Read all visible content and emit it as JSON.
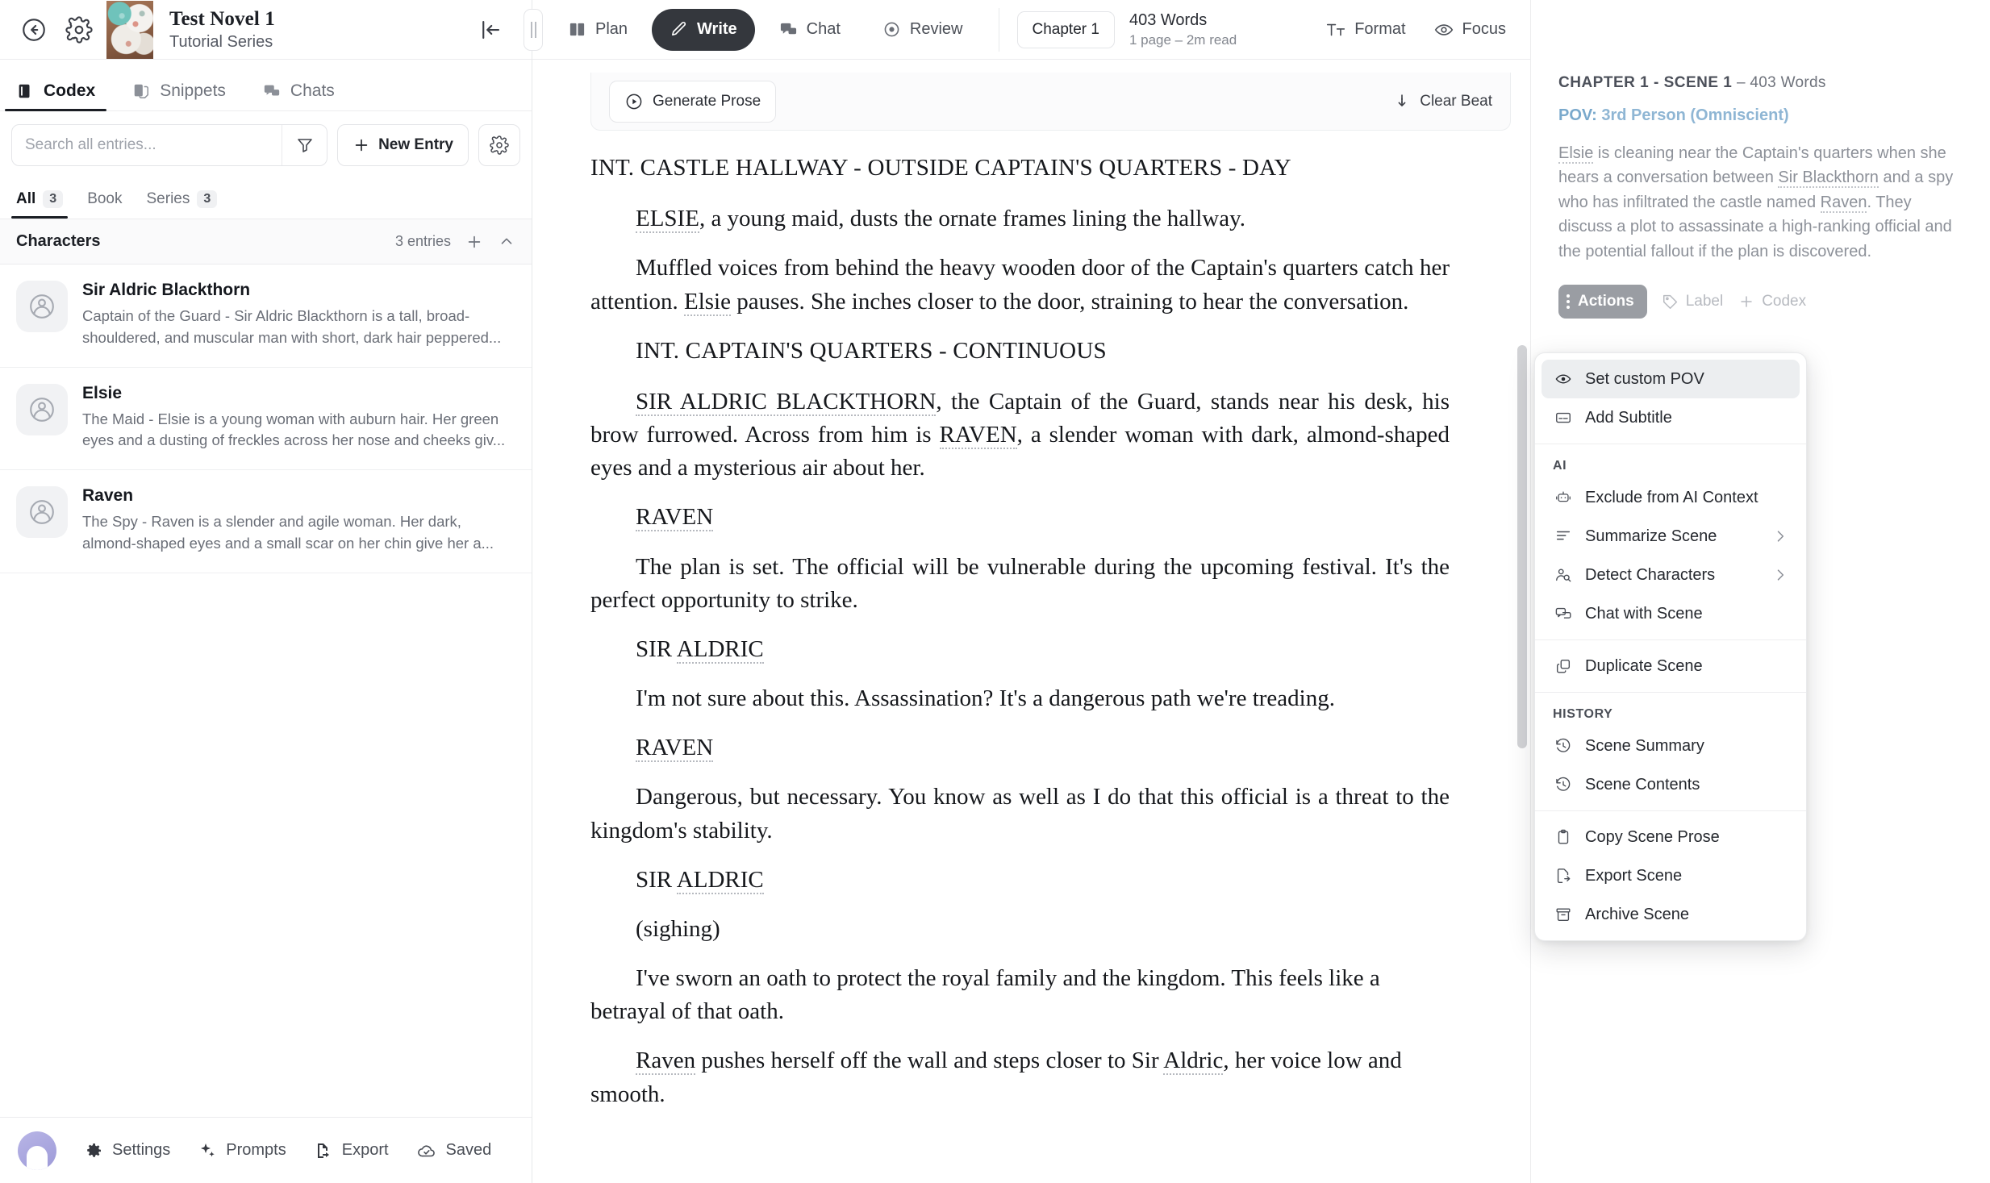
{
  "sidebar": {
    "novel_title": "Test Novel 1",
    "novel_series": "Tutorial Series",
    "back_icon": "back-arrow-icon",
    "settings_icon": "gear-icon",
    "collapse_icon": "collapse-panel-icon",
    "tabs": [
      {
        "label": "Codex",
        "icon": "book-icon",
        "active": true
      },
      {
        "label": "Snippets",
        "icon": "snippets-icon",
        "active": false
      },
      {
        "label": "Chats",
        "icon": "chat-bubbles-icon",
        "active": false
      }
    ],
    "search": {
      "placeholder": "Search all entries...",
      "value": ""
    },
    "filter_icon": "filter-funnel-icon",
    "new_entry_label": "New Entry",
    "entry_settings_icon": "gear-icon",
    "scope_tabs": [
      {
        "label": "All",
        "count": "3",
        "active": true
      },
      {
        "label": "Book",
        "count": "",
        "active": false
      },
      {
        "label": "Series",
        "count": "3",
        "active": false
      }
    ],
    "group": {
      "title": "Characters",
      "count_label": "3 entries",
      "add_icon": "plus-icon",
      "collapse_icon": "chevron-up-icon"
    },
    "entries": [
      {
        "name": "Sir Aldric Blackthorn",
        "description": "Captain of the Guard - Sir Aldric Blackthorn is a tall, broad-shouldered, and muscular man with short, dark hair peppered..."
      },
      {
        "name": "Elsie",
        "description": "The Maid - Elsie is a young woman with auburn hair. Her green eyes and a dusting of freckles across her nose and cheeks giv..."
      },
      {
        "name": "Raven",
        "description": "The Spy - Raven is a slender and agile woman. Her dark, almond-shaped eyes and a small scar on her chin give her a..."
      }
    ],
    "bottom": [
      {
        "label": "Settings",
        "icon": "gear-icon"
      },
      {
        "label": "Prompts",
        "icon": "sparkles-icon"
      },
      {
        "label": "Export",
        "icon": "export-file-icon"
      },
      {
        "label": "Saved",
        "icon": "cloud-check-icon"
      }
    ]
  },
  "topbar": {
    "modes": [
      {
        "label": "Plan",
        "icon": "book-open-icon",
        "active": false
      },
      {
        "label": "Write",
        "icon": "pencil-icon",
        "active": true
      },
      {
        "label": "Chat",
        "icon": "chat-bubbles-icon",
        "active": false
      },
      {
        "label": "Review",
        "icon": "eye-target-icon",
        "active": false
      }
    ],
    "chapter_chip": "Chapter 1",
    "word_count": "403 Words",
    "read_info": "1 page  –  2m read",
    "format_label": "Format",
    "format_icon": "text-format-icon",
    "focus_label": "Focus",
    "focus_icon": "eye-icon"
  },
  "beatbar": {
    "generate_label": "Generate Prose",
    "generate_icon": "play-circle-icon",
    "clear_label": "Clear Beat",
    "clear_icon": "arrow-down-dashed-icon"
  },
  "document": {
    "blocks": [
      {
        "type": "slug",
        "text": "INT. CASTLE HALLWAY - OUTSIDE CAPTAIN'S QUARTERS - DAY"
      },
      {
        "type": "action",
        "text": "ELSIE, a young maid, dusts the ornate frames lining the hallway."
      },
      {
        "type": "action",
        "text": "Muffled voices from behind the heavy wooden door of the Captain's quarters catch her attention. Elsie pauses. She inches closer to the door, straining to hear the conversation."
      },
      {
        "type": "slug2",
        "text": "INT. CAPTAIN'S QUARTERS - CONTINUOUS"
      },
      {
        "type": "action",
        "text": "SIR ALDRIC BLACKTHORN, the Captain of the Guard, stands near his desk, his brow furrowed. Across from him is RAVEN, a slender woman with dark, almond-shaped eyes and a mysterious air about her."
      },
      {
        "type": "cue",
        "text": "RAVEN"
      },
      {
        "type": "dialogue",
        "text": "The plan is set. The official will be vulnerable during the upcoming festival. It's the perfect opportunity to strike."
      },
      {
        "type": "cue",
        "text": "SIR ALDRIC"
      },
      {
        "type": "dialogue",
        "text": "I'm not sure about this. Assassination? It's a dangerous path we're treading."
      },
      {
        "type": "cue",
        "text": "RAVEN"
      },
      {
        "type": "dialogue",
        "text": "Dangerous, but necessary. You know as well as I do that this official is a threat to the kingdom's stability."
      },
      {
        "type": "cue",
        "text": "SIR ALDRIC"
      },
      {
        "type": "paren",
        "text": "(sighing)"
      },
      {
        "type": "dialogue",
        "text": "I've sworn an oath to protect the royal family and the kingdom. This feels like a betrayal of that oath."
      },
      {
        "type": "action",
        "text": "Raven pushes herself off the wall and steps closer to Sir Aldric, her voice low and smooth."
      }
    ]
  },
  "right_panel": {
    "scene_header_bold": "CHAPTER 1 - SCENE 1",
    "scene_header_rest": " –  403 Words",
    "pov_label": "POV:",
    "pov_value": "3rd Person (Omniscient)",
    "summary": "Elsie is cleaning near the Captain's quarters when she hears a conversation between Sir Blackthorn and a spy who has infiltrated the castle named Raven. They discuss a plot to assassinate a high-ranking official and the potential fallout if the plan is discovered.",
    "actions_label": "Actions",
    "label_label": "Label",
    "codex_label": "Codex",
    "menu": [
      {
        "label": "Set custom POV",
        "icon": "eye-icon",
        "highlight": true,
        "submenu": false,
        "type": "item"
      },
      {
        "label": "Add Subtitle",
        "icon": "subtitle-icon",
        "highlight": false,
        "submenu": false,
        "type": "item"
      },
      {
        "type": "separator"
      },
      {
        "label": "AI",
        "type": "section"
      },
      {
        "label": "Exclude from AI Context",
        "icon": "robot-icon",
        "highlight": false,
        "submenu": false,
        "type": "item"
      },
      {
        "label": "Summarize Scene",
        "icon": "summarize-lines-icon",
        "highlight": false,
        "submenu": true,
        "type": "item"
      },
      {
        "label": "Detect Characters",
        "icon": "person-search-icon",
        "highlight": false,
        "submenu": true,
        "type": "item"
      },
      {
        "label": "Chat with Scene",
        "icon": "chat-bubbles-icon",
        "highlight": false,
        "submenu": false,
        "type": "item"
      },
      {
        "type": "separator"
      },
      {
        "label": "Duplicate Scene",
        "icon": "duplicate-icon",
        "highlight": false,
        "submenu": false,
        "type": "item"
      },
      {
        "type": "separator"
      },
      {
        "label": "HISTORY",
        "type": "section"
      },
      {
        "label": "Scene Summary",
        "icon": "history-clock-icon",
        "highlight": false,
        "submenu": false,
        "type": "item"
      },
      {
        "label": "Scene Contents",
        "icon": "history-clock-icon",
        "highlight": false,
        "submenu": false,
        "type": "item"
      },
      {
        "type": "separator"
      },
      {
        "label": "Copy Scene Prose",
        "icon": "clipboard-icon",
        "highlight": false,
        "submenu": false,
        "type": "item"
      },
      {
        "label": "Export Scene",
        "icon": "export-file-icon",
        "highlight": false,
        "submenu": false,
        "type": "item"
      },
      {
        "label": "Archive Scene",
        "icon": "archive-box-icon",
        "highlight": false,
        "submenu": false,
        "type": "item"
      }
    ]
  },
  "colors": {
    "accent_dark": "#34373d",
    "pov_blue": "#8fb6d4",
    "muted": "#8d9199",
    "highlight_bg": "#eceef0"
  }
}
